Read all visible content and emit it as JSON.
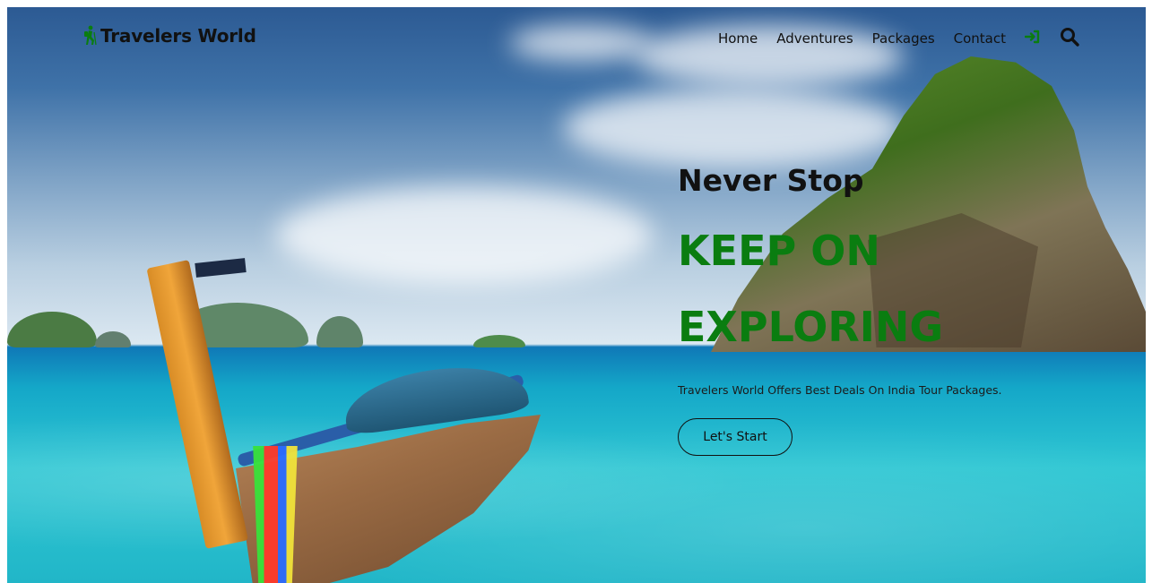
{
  "nav": {
    "brand": "Travelers World",
    "links": [
      "Home",
      "Adventures",
      "Packages",
      "Contact"
    ],
    "login_icon": "sign-in-icon",
    "search_icon": "search-icon"
  },
  "hero": {
    "kicker": "Never Stop",
    "title": "KEEP ON EXPLORING",
    "description": "Travelers World Offers Best Deals On India Tour Packages.",
    "cta_label": "Let's Start"
  },
  "colors": {
    "accent": "#0a7d10",
    "text": "#111111"
  }
}
